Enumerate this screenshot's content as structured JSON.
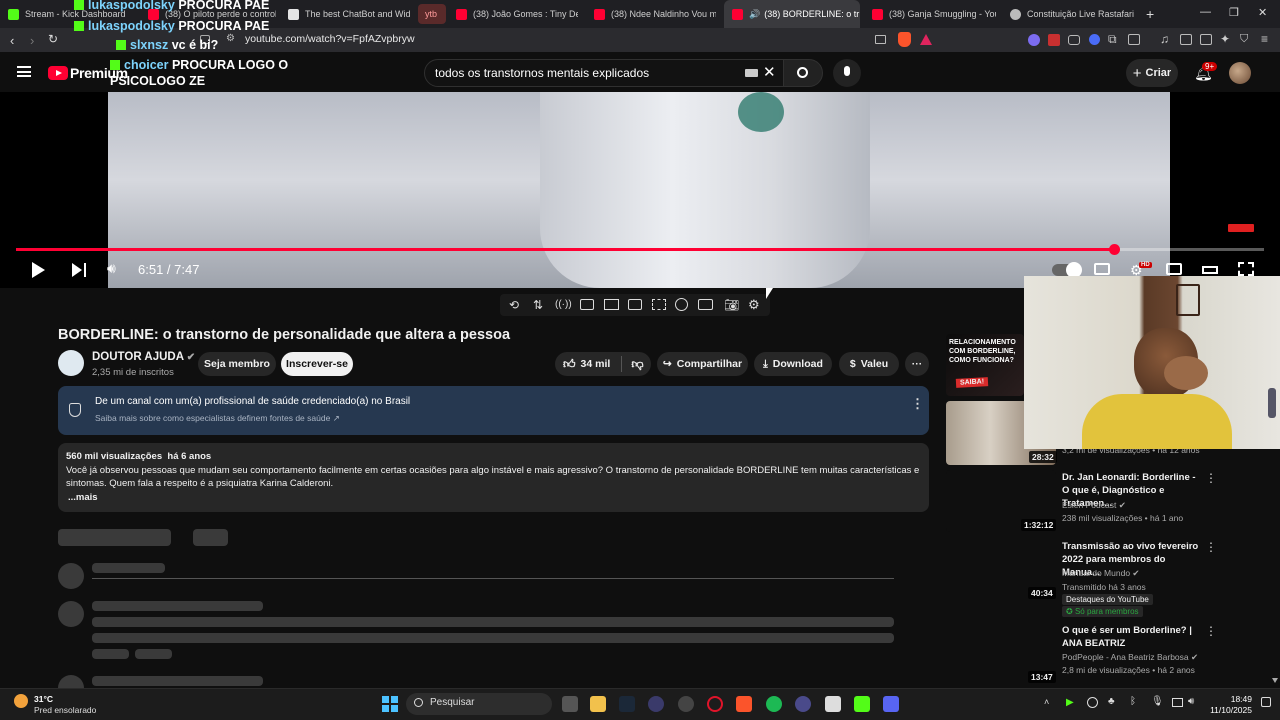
{
  "browser": {
    "tabs": [
      {
        "label": "Stream - Kick Dashboard",
        "color": "#53fc18"
      },
      {
        "label": "(38) O piloto perde o controle",
        "color": "#ff0033"
      },
      {
        "label": "The best ChatBot and Widget",
        "color": "#e5e5e5"
      },
      {
        "label": "ytb",
        "color": "#8e2a2a"
      },
      {
        "label": "(38) João Gomes : Tiny Desk B",
        "color": "#ff0033"
      },
      {
        "label": "(38) Ndee Naldinho Vou mud",
        "color": "#ff0033"
      },
      {
        "label": "(38) BORDERLINE: o tr",
        "color": "#ff0033"
      },
      {
        "label": "(38) Ganja Smuggling - YouTu",
        "color": "#ff0033"
      },
      {
        "label": "Constituição Live Rastafari",
        "color": "#bbbbbb"
      }
    ],
    "url": "youtube.com/watch?v=FpfAZvpbryw"
  },
  "chat_overlay": [
    {
      "user": "lukaspodolsky",
      "message": "PROCURA PAE"
    },
    {
      "user": "lukaspodolsky",
      "message": "PROCURA PAE"
    },
    {
      "user": "slxnsz",
      "message": "vc é bi?"
    },
    {
      "user": "choicer",
      "message": "PROCURA LOGO O PSICOLOGO ZE"
    }
  ],
  "youtube": {
    "logo_text": "Premium",
    "search_query": "todos os transtornos mentais explicados",
    "create_label": "Criar",
    "notif_badge": "9+"
  },
  "player": {
    "time": "6:51 / 7:47",
    "progress": 0.88
  },
  "video": {
    "title": "BORDERLINE: o transtorno de personalidade que altera a pessoa",
    "channel": "DOUTOR AJUDA",
    "subscribers": "2,35 mi de inscritos",
    "member_label": "Seja membro",
    "subscribe_label": "Inscrever-se",
    "likes": "34 mil",
    "share_label": "Compartilhar",
    "download_label": "Download",
    "thanks_label": "Valeu",
    "health_title": "De um canal com um(a) profissional de saúde credenciado(a) no Brasil",
    "health_sub": "Saiba mais sobre como especialistas definem fontes de saúde",
    "views_date": "560 mil visualizações  há 6 anos",
    "description": "Você já observou pessoas que mudam seu comportamento facilmente em certas ocasiões para algo instável e mais agressivo? O transtorno de personalidade BORDERLINE tem muitas características e sintomas. Quem fala a respeito é a psiquiatra Karina Calderoni.",
    "more_label": "...mais"
  },
  "sidebar": [
    {
      "thumb_text": "RELACIONAMENTO COM BORDERLINE, COMO FUNCIONA?",
      "thumb_badge": "SAIBA!",
      "duration": "",
      "title": "",
      "channel": "",
      "meta": ""
    },
    {
      "thumb_text": "",
      "thumb_badge": "",
      "duration": "28:32",
      "title": "",
      "channel": "",
      "meta": "3,2 mi de visualizações • há 12 anos"
    },
    {
      "duration": "1:32:12",
      "title": "Dr. Jan Leonardi: Borderline - O que é, Diagnóstico e Tratamen...",
      "channel": "Eslen Podcast",
      "meta": "238 mil visualizações • há 1 ano"
    },
    {
      "duration": "40:34",
      "title": "Transmissão ao vivo fevereiro 2022 para membros do Manua...",
      "channel": "Manual do Mundo",
      "meta": "Transmitido há 3 anos",
      "tag1": "Destaques do YouTube",
      "tag2": "Só para membros"
    },
    {
      "duration": "13:47",
      "title": "O que é ser um Borderline? | ANA BEATRIZ",
      "channel": "PodPeople - Ana Beatriz Barbosa",
      "meta": "2,8 mi de visualizações • há 2 anos"
    }
  ],
  "taskbar": {
    "temp": "31°C",
    "weather": "Pred ensolarado",
    "search_label": "Pesquisar",
    "time": "18:49",
    "date": "11/10/2025"
  }
}
